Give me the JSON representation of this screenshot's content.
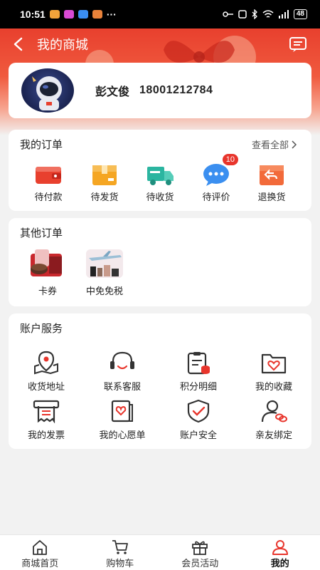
{
  "status_bar": {
    "time": "10:51",
    "more": "···",
    "battery": "48"
  },
  "nav": {
    "title": "我的商城"
  },
  "profile": {
    "name": "彭文俊",
    "phone": "18001212784"
  },
  "my_orders": {
    "title": "我的订单",
    "view_all": "查看全部",
    "items": [
      {
        "label": "待付款",
        "icon": "wallet-icon"
      },
      {
        "label": "待发货",
        "icon": "box-icon"
      },
      {
        "label": "待收货",
        "icon": "truck-icon"
      },
      {
        "label": "待评价",
        "icon": "chat-bubble-icon",
        "badge": "10"
      },
      {
        "label": "退换货",
        "icon": "return-box-icon"
      }
    ]
  },
  "other_orders": {
    "title": "其他订单",
    "items": [
      {
        "label": "卡券",
        "icon": "voucher-image"
      },
      {
        "label": "中免免税",
        "icon": "duty-free-image"
      }
    ]
  },
  "account_services": {
    "title": "账户服务",
    "items": [
      {
        "label": "收货地址",
        "icon": "map-pin-icon"
      },
      {
        "label": "联系客服",
        "icon": "headset-icon"
      },
      {
        "label": "积分明细",
        "icon": "points-clipboard-icon"
      },
      {
        "label": "我的收藏",
        "icon": "heart-folder-icon"
      },
      {
        "label": "我的发票",
        "icon": "invoice-printer-icon"
      },
      {
        "label": "我的心愿单",
        "icon": "wishlist-icon"
      },
      {
        "label": "账户安全",
        "icon": "shield-check-icon"
      },
      {
        "label": "亲友绑定",
        "icon": "user-link-icon"
      }
    ]
  },
  "tab_bar": {
    "items": [
      {
        "label": "商城首页",
        "icon": "home-icon"
      },
      {
        "label": "购物车",
        "icon": "cart-icon"
      },
      {
        "label": "会员活动",
        "icon": "gift-icon"
      },
      {
        "label": "我的",
        "icon": "user-icon",
        "active": true
      }
    ]
  },
  "colors": {
    "brand": "#e8402e",
    "accent": "#e8352c"
  }
}
